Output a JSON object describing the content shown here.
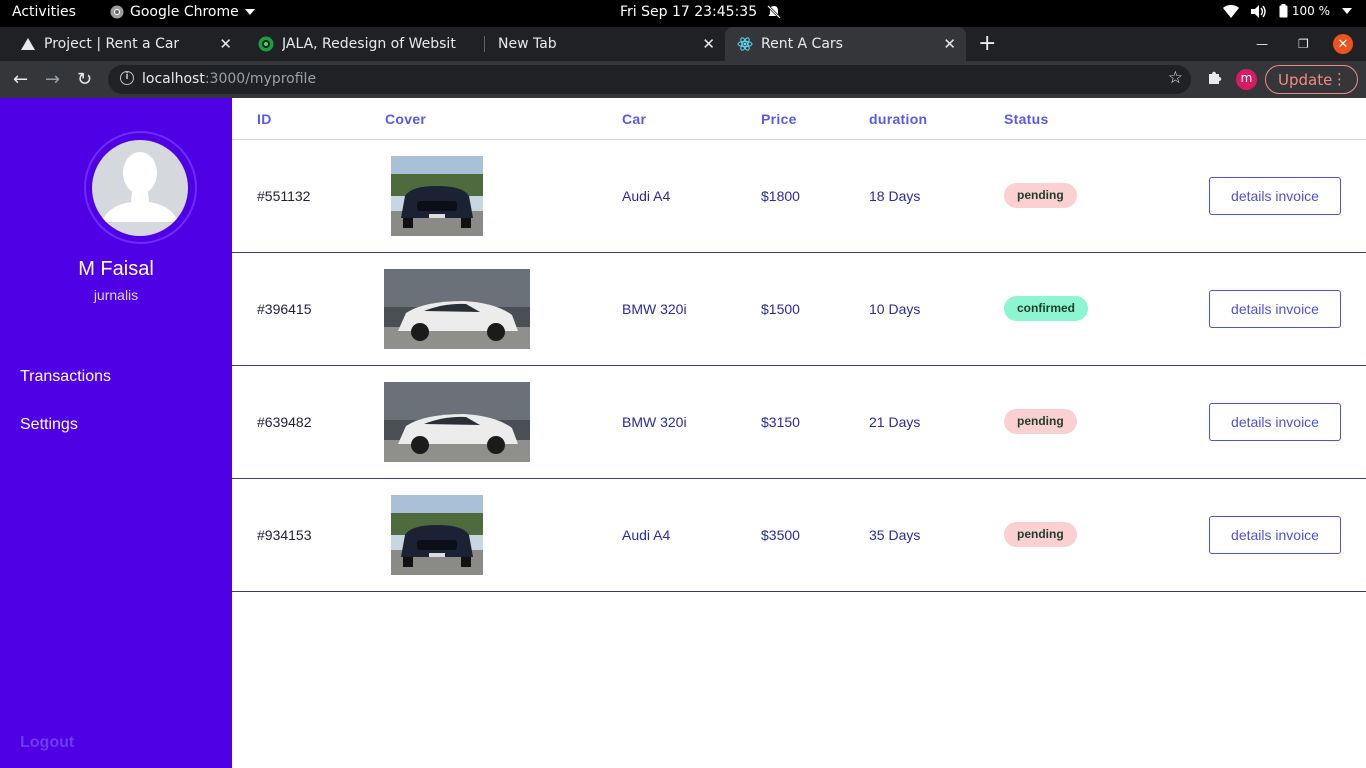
{
  "os_bar": {
    "activities": "Activities",
    "app_name": "Google Chrome",
    "clock": "Fri Sep 17  23:45:35",
    "battery": "100 %"
  },
  "browser": {
    "tabs": [
      {
        "title": "Project | Rent a Car",
        "active": false
      },
      {
        "title": "JALA, Redesign of Websit",
        "active": false
      },
      {
        "title": "New Tab",
        "active": false
      },
      {
        "title": "Rent A Cars",
        "active": true
      }
    ],
    "url_host": "localhost",
    "url_path": ":3000/myprofile",
    "profile_initial": "m",
    "update_label": "Update"
  },
  "sidebar": {
    "name": "M Faisal",
    "role": "jurnalis",
    "nav": [
      {
        "label": "Transactions"
      },
      {
        "label": "Settings"
      }
    ],
    "logout": "Logout"
  },
  "table": {
    "headers": {
      "id": "ID",
      "cover": "Cover",
      "car": "Car",
      "price": "Price",
      "duration": "duration",
      "status": "Status"
    },
    "rows": [
      {
        "id": "#551132",
        "car": "Audi A4",
        "price": "$1800",
        "duration": "18 Days",
        "status": "pending",
        "button": "details invoice"
      },
      {
        "id": "#396415",
        "car": "BMW 320i",
        "price": "$1500",
        "duration": "10 Days",
        "status": "confirmed",
        "button": "details invoice"
      },
      {
        "id": "#639482",
        "car": "BMW 320i",
        "price": "$3150",
        "duration": "21 Days",
        "status": "pending",
        "button": "details invoice"
      },
      {
        "id": "#934153",
        "car": "Audi A4",
        "price": "$3500",
        "duration": "35 Days",
        "status": "pending",
        "button": "details invoice"
      }
    ]
  },
  "colors": {
    "sidebar_bg": "#5000e4",
    "accent": "#5a5ae8",
    "pending_bg": "#fbd0d0",
    "confirmed_bg": "#8ef5d2"
  }
}
